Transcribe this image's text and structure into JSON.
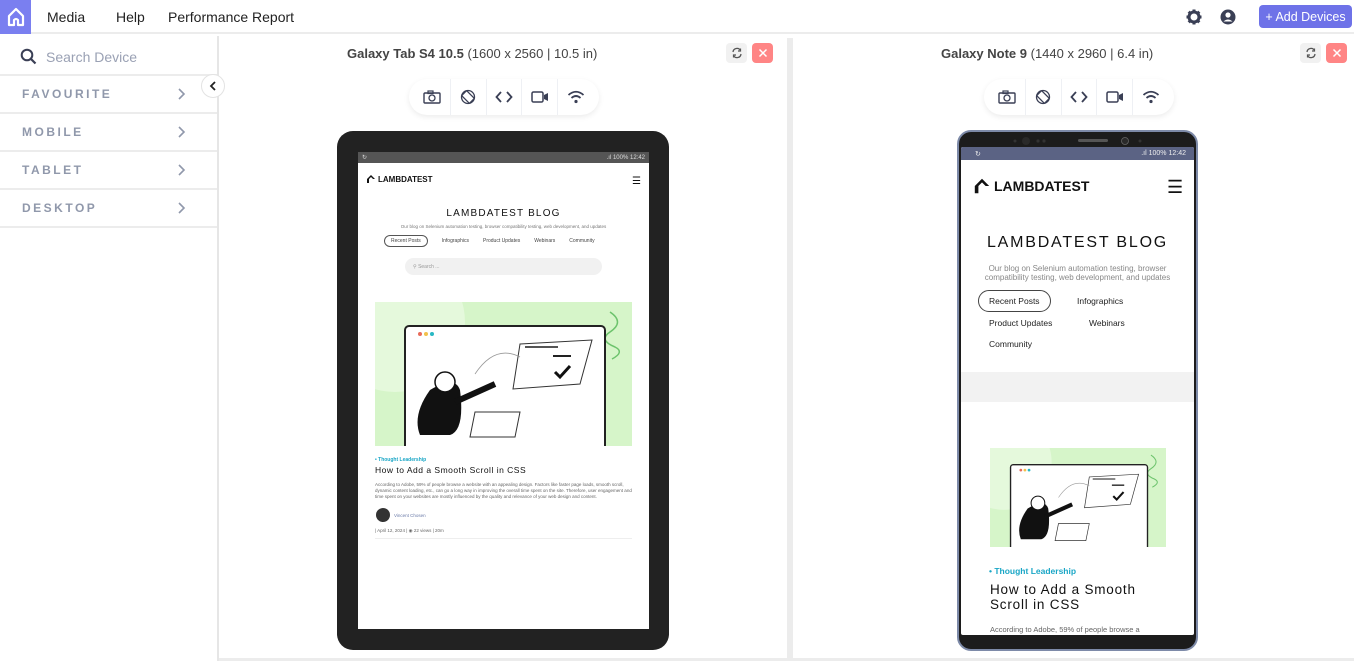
{
  "topbar": {
    "home_icon": "home-icon",
    "nav": [
      "Media",
      "Help",
      "Performance Report"
    ],
    "add_devices_label": "+ Add Devices",
    "accent": "#6e72e8"
  },
  "sidebar": {
    "search_placeholder": "Search Device",
    "categories": [
      {
        "label": "FAVOURITE"
      },
      {
        "label": "MOBILE"
      },
      {
        "label": "TABLET"
      },
      {
        "label": "DESKTOP"
      }
    ]
  },
  "panes": [
    {
      "device_name": "Galaxy Tab S4 10.5",
      "device_spec": "(1600 x 2560 | 10.5 in)",
      "statusbar": {
        "signal": ".ıl 100%",
        "time": "12:42"
      },
      "site": {
        "logo": "LAMBDATEST",
        "title": "LAMBDATEST BLOG",
        "subtitle": "Our blog on Selenium automation testing, browser compatibility testing, web development, and updates",
        "tabs": [
          "Recent Posts",
          "Infographics",
          "Product Updates",
          "Webinars",
          "Community"
        ],
        "search_placeholder": "Search ...",
        "post": {
          "category": "Thought Leadership",
          "title": "How to Add a Smooth Scroll in CSS",
          "excerpt": "According to Adobe, 59% of people browse a website with an appealing design. Factors like faster page loads, smooth scroll, dynamic content loading, etc., can go a long way in improving the overall time spent on the site. Therefore, user engagement and time spent on your websites are mostly influenced by the quality and relevance of your web design and content.",
          "author": "Vincent Chosen",
          "date": "April 12, 2024",
          "views": "22 views",
          "read_time": "20m"
        }
      }
    },
    {
      "device_name": "Galaxy Note 9",
      "device_spec": "(1440 x 2960 | 6.4 in)",
      "statusbar": {
        "signal": ".ıl 100%",
        "time": "12:42"
      },
      "site": {
        "logo": "LAMBDATEST",
        "title": "LAMBDATEST BLOG",
        "subtitle": "Our blog on Selenium automation testing, browser compatibility testing, web development, and updates",
        "tabs": [
          "Recent Posts",
          "Infographics",
          "Product Updates",
          "Webinars",
          "Community"
        ],
        "post": {
          "category": "Thought Leadership",
          "title": "How to Add a Smooth Scroll in CSS",
          "excerpt": "According to Adobe, 59% of people browse a"
        }
      }
    }
  ],
  "toolbar_icons": [
    "camera-icon",
    "rotate-icon",
    "code-icon",
    "video-icon",
    "wifi-icon"
  ]
}
